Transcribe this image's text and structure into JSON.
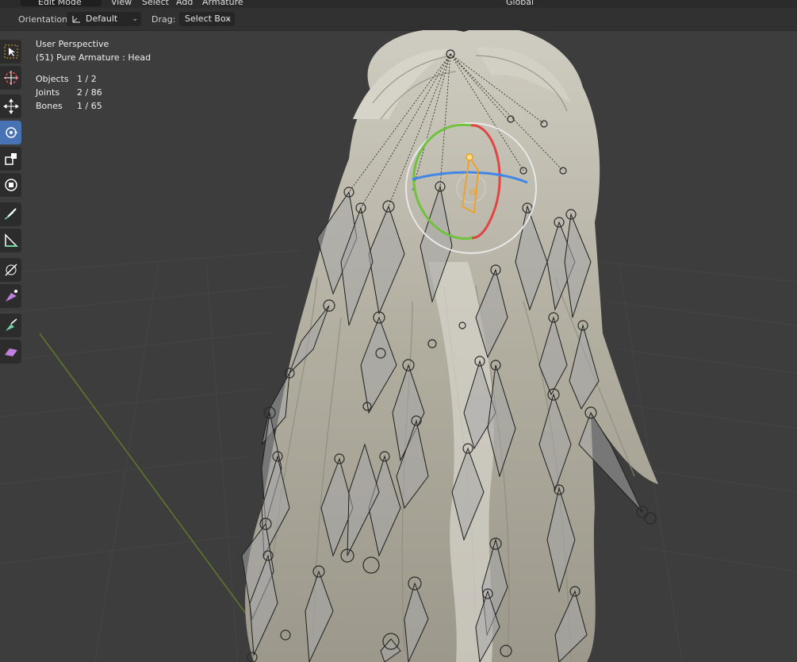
{
  "topbar": {
    "mode": "Edit Mode",
    "menus": [
      "View",
      "Select",
      "Add",
      "Armature"
    ],
    "transform_orientation": "Global"
  },
  "header": {
    "orientation_label": "Orientation:",
    "orientation_value": "Default",
    "drag_label": "Drag:",
    "drag_value": "Select Box"
  },
  "toolbar": {
    "tools": [
      {
        "name": "select-box",
        "icon": "cursor-select-icon",
        "active": false
      },
      {
        "name": "cursor",
        "icon": "3d-cursor-icon",
        "active": false
      },
      {
        "name": "move",
        "icon": "move-arrows-icon",
        "active": false
      },
      {
        "name": "rotate",
        "icon": "rotate-icon",
        "active": true
      },
      {
        "name": "scale",
        "icon": "scale-icon",
        "active": false
      },
      {
        "name": "transform",
        "icon": "transform-icon",
        "active": false
      },
      {
        "name": "annotate",
        "icon": "annotate-pen-icon",
        "active": false
      },
      {
        "name": "measure",
        "icon": "measure-ruler-icon",
        "active": false
      },
      {
        "name": "roll",
        "icon": "bone-roll-icon",
        "active": false
      },
      {
        "name": "bone-size",
        "icon": "bone-size-icon",
        "active": false
      },
      {
        "name": "extrude",
        "icon": "extrude-icon",
        "active": false
      },
      {
        "name": "shear",
        "icon": "shear-icon",
        "active": false
      }
    ]
  },
  "viewport": {
    "view_name": "User Perspective",
    "object_info": "(51) Pure Armature : Head",
    "stats": [
      {
        "name": "Objects",
        "value": "1 / 2"
      },
      {
        "name": "Joints",
        "value": "2 / 86"
      },
      {
        "name": "Bones",
        "value": "1 / 65"
      }
    ]
  },
  "colors": {
    "background": "#3d3d3d",
    "active_tool": "#4772b3",
    "gizmo_x": "#e04545",
    "gizmo_y": "#6fc23b",
    "gizmo_z": "#3f86e6",
    "selected_bone": "#f0a020",
    "hair": "#b8b4a7"
  }
}
